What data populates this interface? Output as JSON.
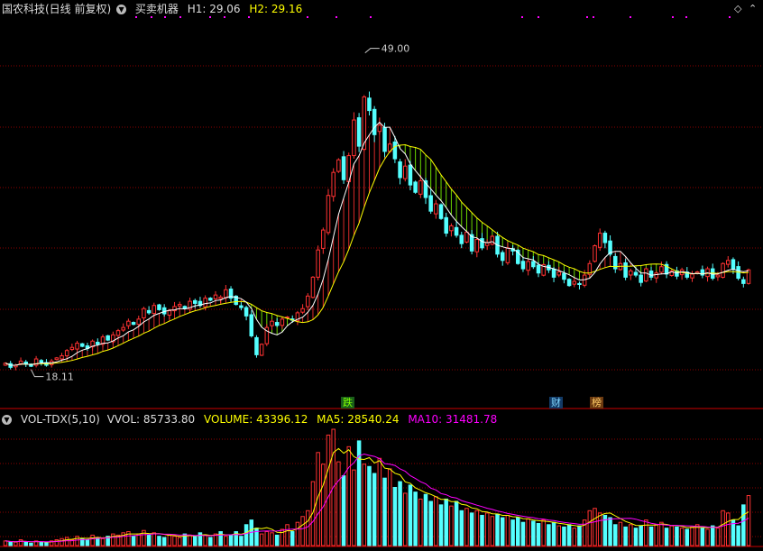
{
  "header": {
    "title": "国农科技(日线 前复权)",
    "indicator": "买卖机器",
    "h1": "H1: 29.06",
    "h2": "H2: 29.16"
  },
  "price_labels": {
    "high": "49.00",
    "low": "18.11"
  },
  "markers": {
    "die": "跌",
    "cai": "财",
    "bang": "榜"
  },
  "volume_header": {
    "name": "VOL-TDX(5,10)",
    "vvol": "VVOL: 85733.80",
    "volume": "VOLUME: 43396.12",
    "ma5": "MA5: 28540.24",
    "ma10": "MA10: 31481.78"
  },
  "corner_icons": [
    "diamond-icon",
    "chevron-icon"
  ],
  "colors": {
    "up": "#ff3232",
    "down": "#54ffff",
    "ma_fast": "#ffffff",
    "ma_slow": "#ffff00",
    "fill_up": "#ff3232",
    "fill_down": "#7fff00",
    "ma5_vol": "#ffff00",
    "ma10_vol": "#ff00ff",
    "grid": "#8b0000"
  },
  "chart_data": {
    "type": "candlestick",
    "price_range": [
      15.5,
      52.5
    ],
    "annotated_high": 49.0,
    "annotated_low": 18.11,
    "closes": [
      19.4,
      19.0,
      19.2,
      19.6,
      19.3,
      19.1,
      19.8,
      19.5,
      19.2,
      19.6,
      19.9,
      20.1,
      20.6,
      20.9,
      21.3,
      21.0,
      20.8,
      21.5,
      21.2,
      21.9,
      21.6,
      22.1,
      22.5,
      22.8,
      23.4,
      23.1,
      23.6,
      24.6,
      24.2,
      24.9,
      24.5,
      24.1,
      24.4,
      24.8,
      25.0,
      24.6,
      25.3,
      25.1,
      24.9,
      25.6,
      25.4,
      25.9,
      25.7,
      26.4,
      25.6,
      25.0,
      24.7,
      23.9,
      22.0,
      20.2,
      21.2,
      22.8,
      23.4,
      23.0,
      23.6,
      23.8,
      23.5,
      24.2,
      24.6,
      25.8,
      27.6,
      30.2,
      32.1,
      35.4,
      37.6,
      38.8,
      36.9,
      39.2,
      42.6,
      40.1,
      44.8,
      43.5,
      41.2,
      42.1,
      39.6,
      40.3,
      38.9,
      37.1,
      38.2,
      36.4,
      35.7,
      36.8,
      35.2,
      33.9,
      34.6,
      33.2,
      31.8,
      32.5,
      31.6,
      30.8,
      31.9,
      30.1,
      31.2,
      30.4,
      30.9,
      31.5,
      29.8,
      29.2,
      30.4,
      30.1,
      28.9,
      28.4,
      29.1,
      28.6,
      28.0,
      28.8,
      28.3,
      27.6,
      28.1,
      27.4,
      26.8,
      27.2,
      26.9,
      27.8,
      28.9,
      30.6,
      31.8,
      30.9,
      29.8,
      28.4,
      28.9,
      27.6,
      28.2,
      27.8,
      27.1,
      28.4,
      27.6,
      28.0,
      28.6,
      27.9,
      28.2,
      27.7,
      28.3,
      27.6,
      27.9,
      28.1,
      27.8,
      28.4,
      27.5,
      27.8,
      28.9,
      29.2,
      28.4,
      27.5,
      27.0,
      28.3
    ],
    "volume": [
      4,
      3,
      3,
      5,
      3,
      2,
      4,
      3,
      3,
      4,
      5,
      6,
      7,
      5,
      8,
      6,
      5,
      9,
      7,
      6,
      8,
      10,
      9,
      11,
      12,
      8,
      10,
      13,
      9,
      11,
      8,
      7,
      9,
      8,
      7,
      10,
      9,
      8,
      11,
      9,
      7,
      10,
      12,
      8,
      9,
      12,
      8,
      18,
      22,
      15,
      10,
      12,
      11,
      9,
      14,
      18,
      12,
      20,
      25,
      30,
      55,
      80,
      70,
      95,
      100,
      72,
      60,
      85,
      65,
      90,
      70,
      68,
      62,
      75,
      58,
      66,
      50,
      55,
      45,
      52,
      46,
      40,
      44,
      38,
      42,
      35,
      40,
      34,
      38,
      30,
      32,
      28,
      30,
      26,
      28,
      25,
      27,
      24,
      26,
      22,
      24,
      20,
      23,
      21,
      19,
      22,
      18,
      20,
      17,
      16,
      18,
      15,
      17,
      22,
      30,
      32,
      28,
      26,
      24,
      18,
      20,
      16,
      18,
      15,
      17,
      22,
      16,
      18,
      20,
      15,
      17,
      16,
      15,
      14,
      16,
      18,
      15,
      14,
      17,
      15,
      30,
      28,
      22,
      17,
      35,
      43
    ],
    "series": [
      {
        "name": "VOLUME",
        "value": 43396.12
      },
      {
        "name": "MA5",
        "value": 28540.24
      },
      {
        "name": "MA10",
        "value": 31481.78
      }
    ]
  }
}
